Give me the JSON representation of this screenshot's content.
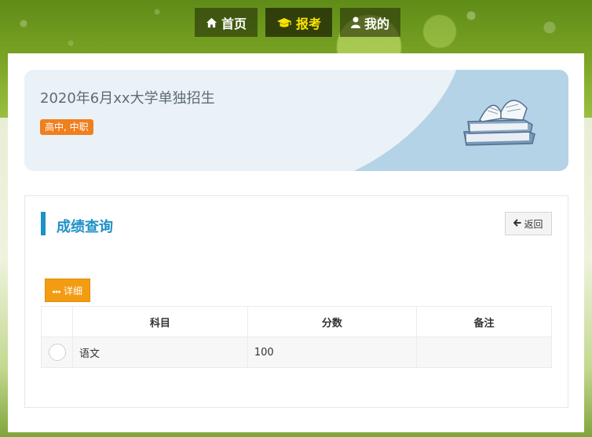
{
  "nav": {
    "items": [
      {
        "label": "首页",
        "icon": "home-icon"
      },
      {
        "label": "报考",
        "icon": "graduation-cap-icon",
        "active": true
      },
      {
        "label": "我的",
        "icon": "user-icon"
      }
    ],
    "active_color": "#ffe400"
  },
  "banner": {
    "title": "2020年6月xx大学单独招生",
    "tag": "高中, 中职"
  },
  "panel": {
    "title": "成绩查询",
    "back_label": "返回",
    "detail_label": "详细"
  },
  "table": {
    "headers": [
      "科目",
      "分数",
      "备注"
    ],
    "rows": [
      {
        "subject": "语文",
        "score": "100",
        "remark": ""
      }
    ]
  },
  "colors": {
    "accent": "#1e90c8",
    "tag": "#f07f1e",
    "detail_button": "#f39c12"
  }
}
